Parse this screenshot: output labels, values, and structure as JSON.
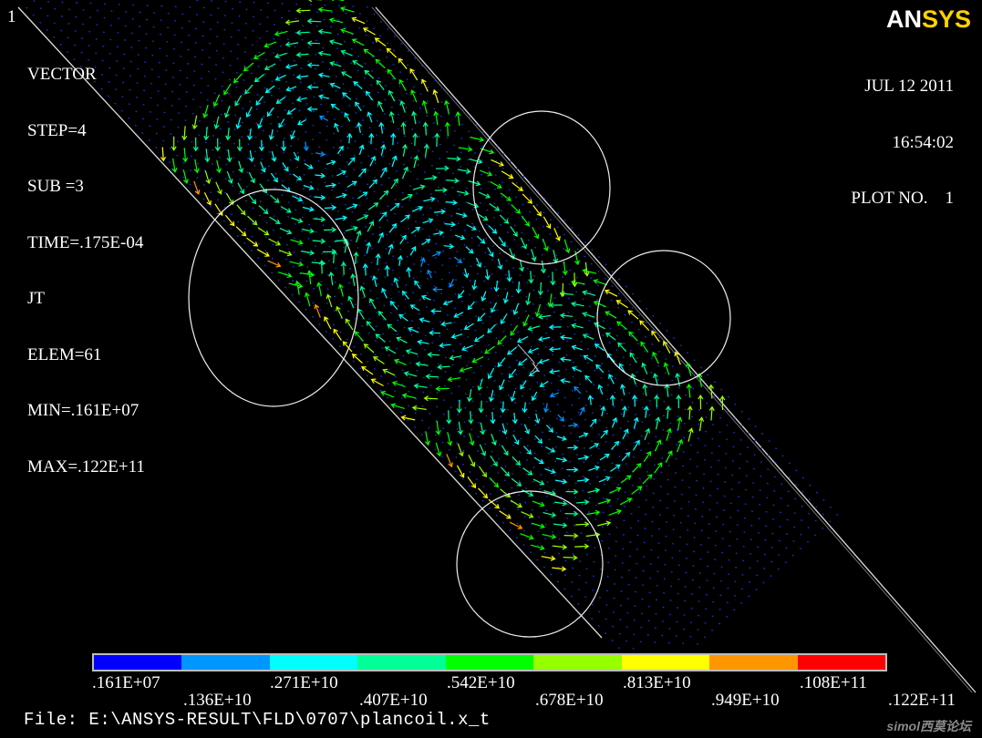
{
  "window_number": "1",
  "info": {
    "lines": [
      "VECTOR",
      "STEP=4",
      "SUB =3",
      "TIME=.175E-04",
      "JT",
      "ELEM=61",
      "MIN=.161E+07",
      "MAX=.122E+11"
    ]
  },
  "date": "JUL 12 2011",
  "time": "16:54:02",
  "plot_no": "PLOT NO.    1",
  "logo": {
    "part1": "AN",
    "part2": "SYS"
  },
  "legend": {
    "colors": [
      "#0000ff",
      "#0096ff",
      "#00ffff",
      "#00ff96",
      "#00ff00",
      "#96ff00",
      "#ffff00",
      "#ff9600",
      "#ff0000"
    ],
    "labels_top": [
      ".161E+07",
      ".271E+10",
      ".542E+10",
      ".813E+10",
      ".108E+11"
    ],
    "labels_bottom": [
      ".136E+10",
      ".407E+10",
      ".678E+10",
      ".949E+10",
      ".122E+11"
    ]
  },
  "triad_label": "X",
  "file_line": "File: E:\\ANSYS-RESULT\\FLD\\0707\\plancoil.x_t",
  "watermark": "simol西莫论坛"
}
